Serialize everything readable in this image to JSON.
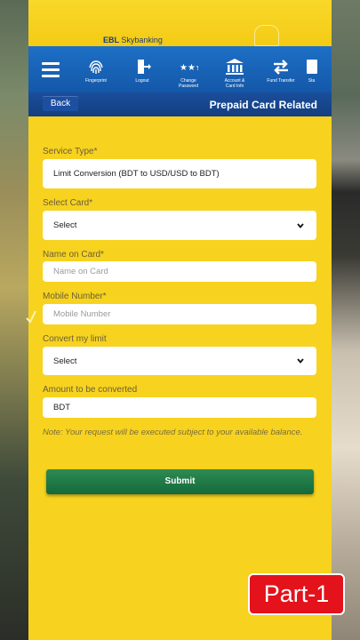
{
  "brand": {
    "name_bold": "EBL",
    "name_light": "Skybanking"
  },
  "nav": {
    "items": [
      {
        "label": "Fingerprint",
        "icon": "fingerprint-icon"
      },
      {
        "label": "Logout",
        "icon": "logout-icon"
      },
      {
        "label": "Change\nPassword",
        "icon": "password-icon"
      },
      {
        "label": "Account &\nCard Info",
        "icon": "bank-icon"
      },
      {
        "label": "Fund Transfer",
        "icon": "transfer-icon"
      },
      {
        "label": "Sta",
        "icon": "statement-icon"
      }
    ]
  },
  "subbar": {
    "back_label": "Back",
    "title": "Prepaid Card Related"
  },
  "form": {
    "service_type": {
      "label": "Service Type*",
      "value": "Limit Conversion (BDT to USD/USD to BDT)"
    },
    "select_card": {
      "label": "Select Card*",
      "value": "Select"
    },
    "name_on_card": {
      "label": "Name on Card*",
      "placeholder": "Name on Card"
    },
    "mobile_number": {
      "label": "Mobile Number*",
      "placeholder": "Mobile Number"
    },
    "convert_limit": {
      "label": "Convert my limit",
      "value": "Select"
    },
    "amount": {
      "label": "Amount to be converted",
      "value": "BDT"
    },
    "note": "Note: Your request will be executed subject to your available balance.",
    "submit_label": "Submit"
  },
  "badge": {
    "text": "Part-1"
  },
  "colors": {
    "panel": "#f7d21f",
    "nav_blue": "#1d6fc7",
    "submit_green": "#1c7a45",
    "badge_red": "#e3121b"
  }
}
